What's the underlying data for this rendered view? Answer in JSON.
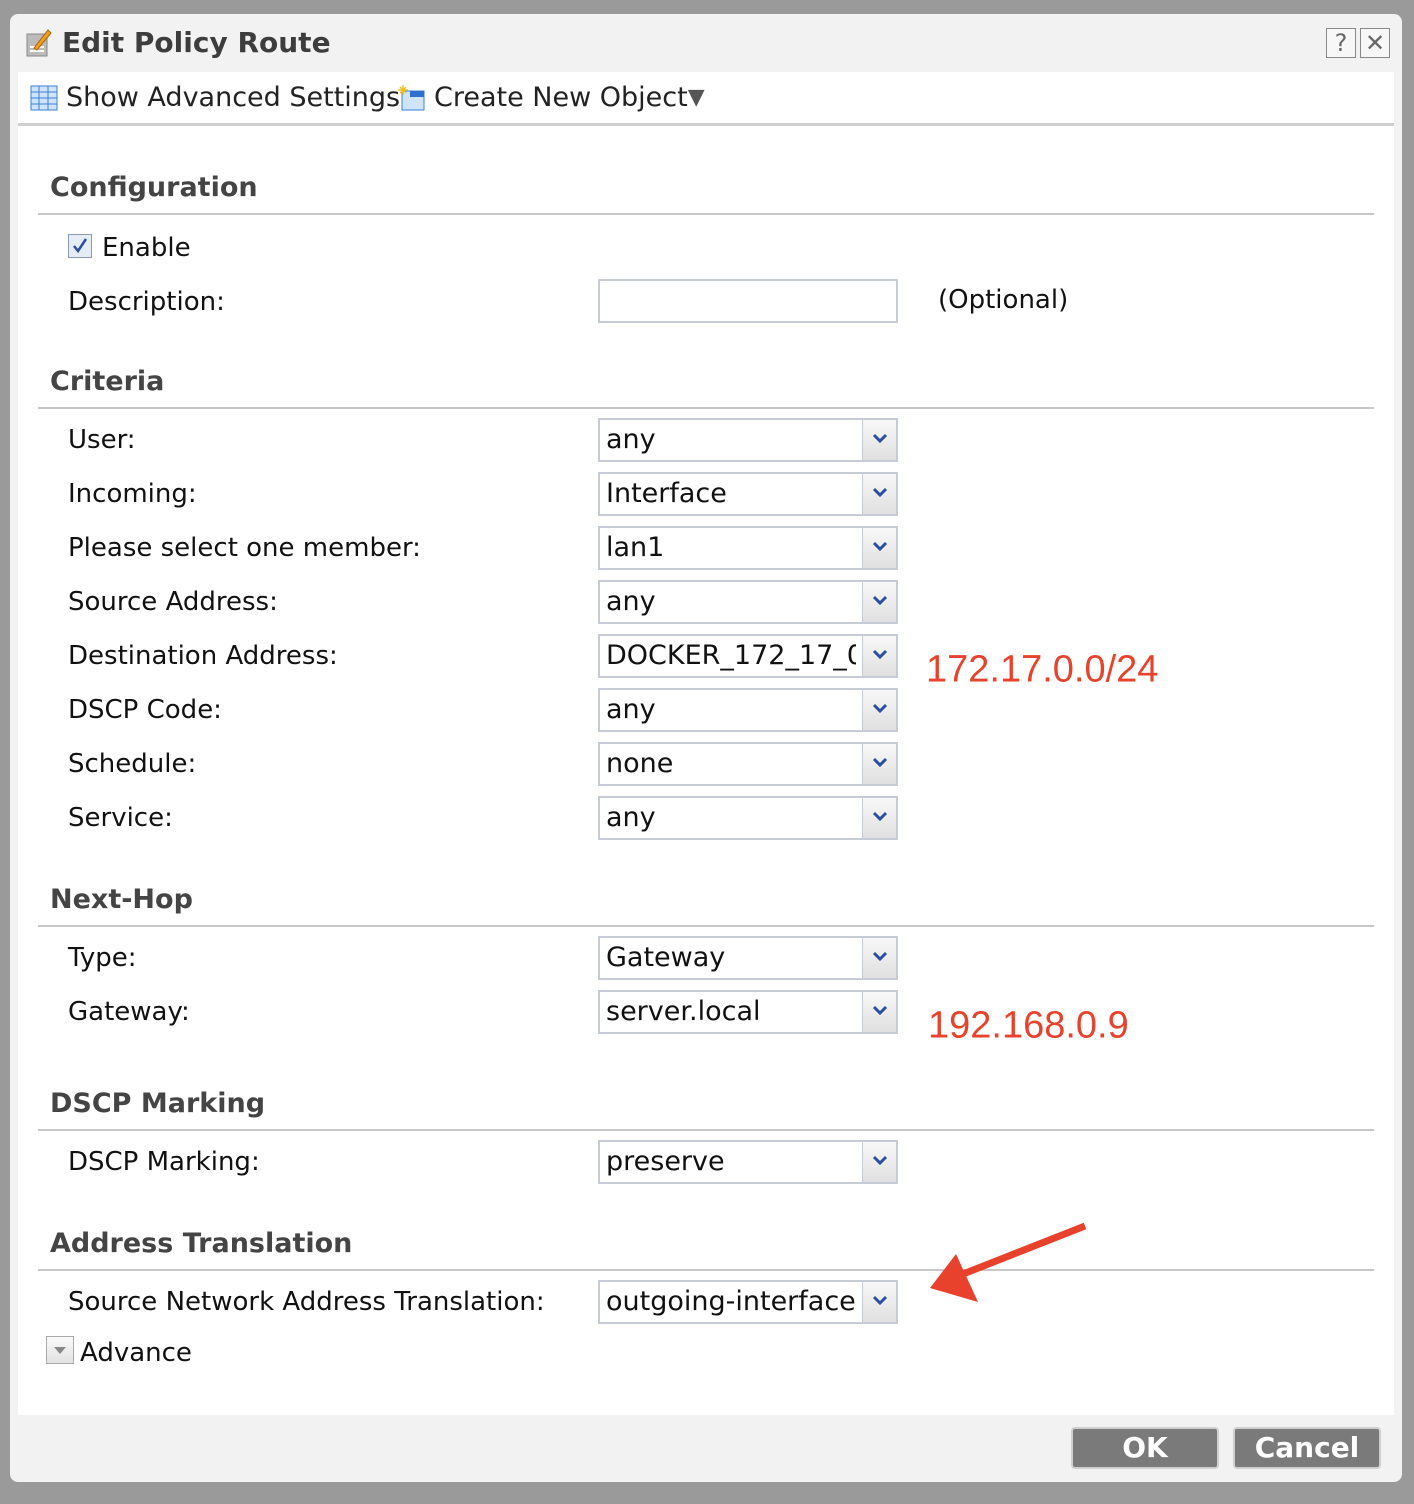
{
  "dialog": {
    "title": "Edit Policy Route",
    "help_label": "?",
    "close_label": "✕"
  },
  "toolbar": {
    "show_advanced": "Show Advanced Settings",
    "create_new": "Create New Object",
    "create_new_caret": "▼"
  },
  "configuration": {
    "header": "Configuration",
    "enable_label": "Enable",
    "enable_checked": true,
    "description_label": "Description:",
    "description_value": "",
    "optional": "(Optional)"
  },
  "criteria": {
    "header": "Criteria",
    "rows": [
      {
        "label": "User:",
        "value": "any"
      },
      {
        "label": "Incoming:",
        "value": "Interface"
      },
      {
        "label": "Please select one member:",
        "value": "lan1"
      },
      {
        "label": "Source Address:",
        "value": "any"
      },
      {
        "label": "Destination Address:",
        "value": "DOCKER_172_17_0_"
      },
      {
        "label": "DSCP Code:",
        "value": "any"
      },
      {
        "label": "Schedule:",
        "value": "none"
      },
      {
        "label": "Service:",
        "value": "any"
      }
    ]
  },
  "nexthop": {
    "header": "Next-Hop",
    "rows": [
      {
        "label": "Type:",
        "value": "Gateway"
      },
      {
        "label": "Gateway:",
        "value": "server.local"
      }
    ]
  },
  "dscp": {
    "header": "DSCP Marking",
    "rows": [
      {
        "label": "DSCP Marking:",
        "value": "preserve"
      }
    ]
  },
  "translation": {
    "header": "Address Translation",
    "rows": [
      {
        "label": "Source Network Address Translation:",
        "value": "outgoing-interface"
      }
    ],
    "advance_label": "Advance"
  },
  "annotations": {
    "destination_note": "172.17.0.0/24",
    "gateway_note": "192.168.0.9",
    "color": "#e8412c"
  },
  "buttons": {
    "ok": "OK",
    "cancel": "Cancel"
  }
}
